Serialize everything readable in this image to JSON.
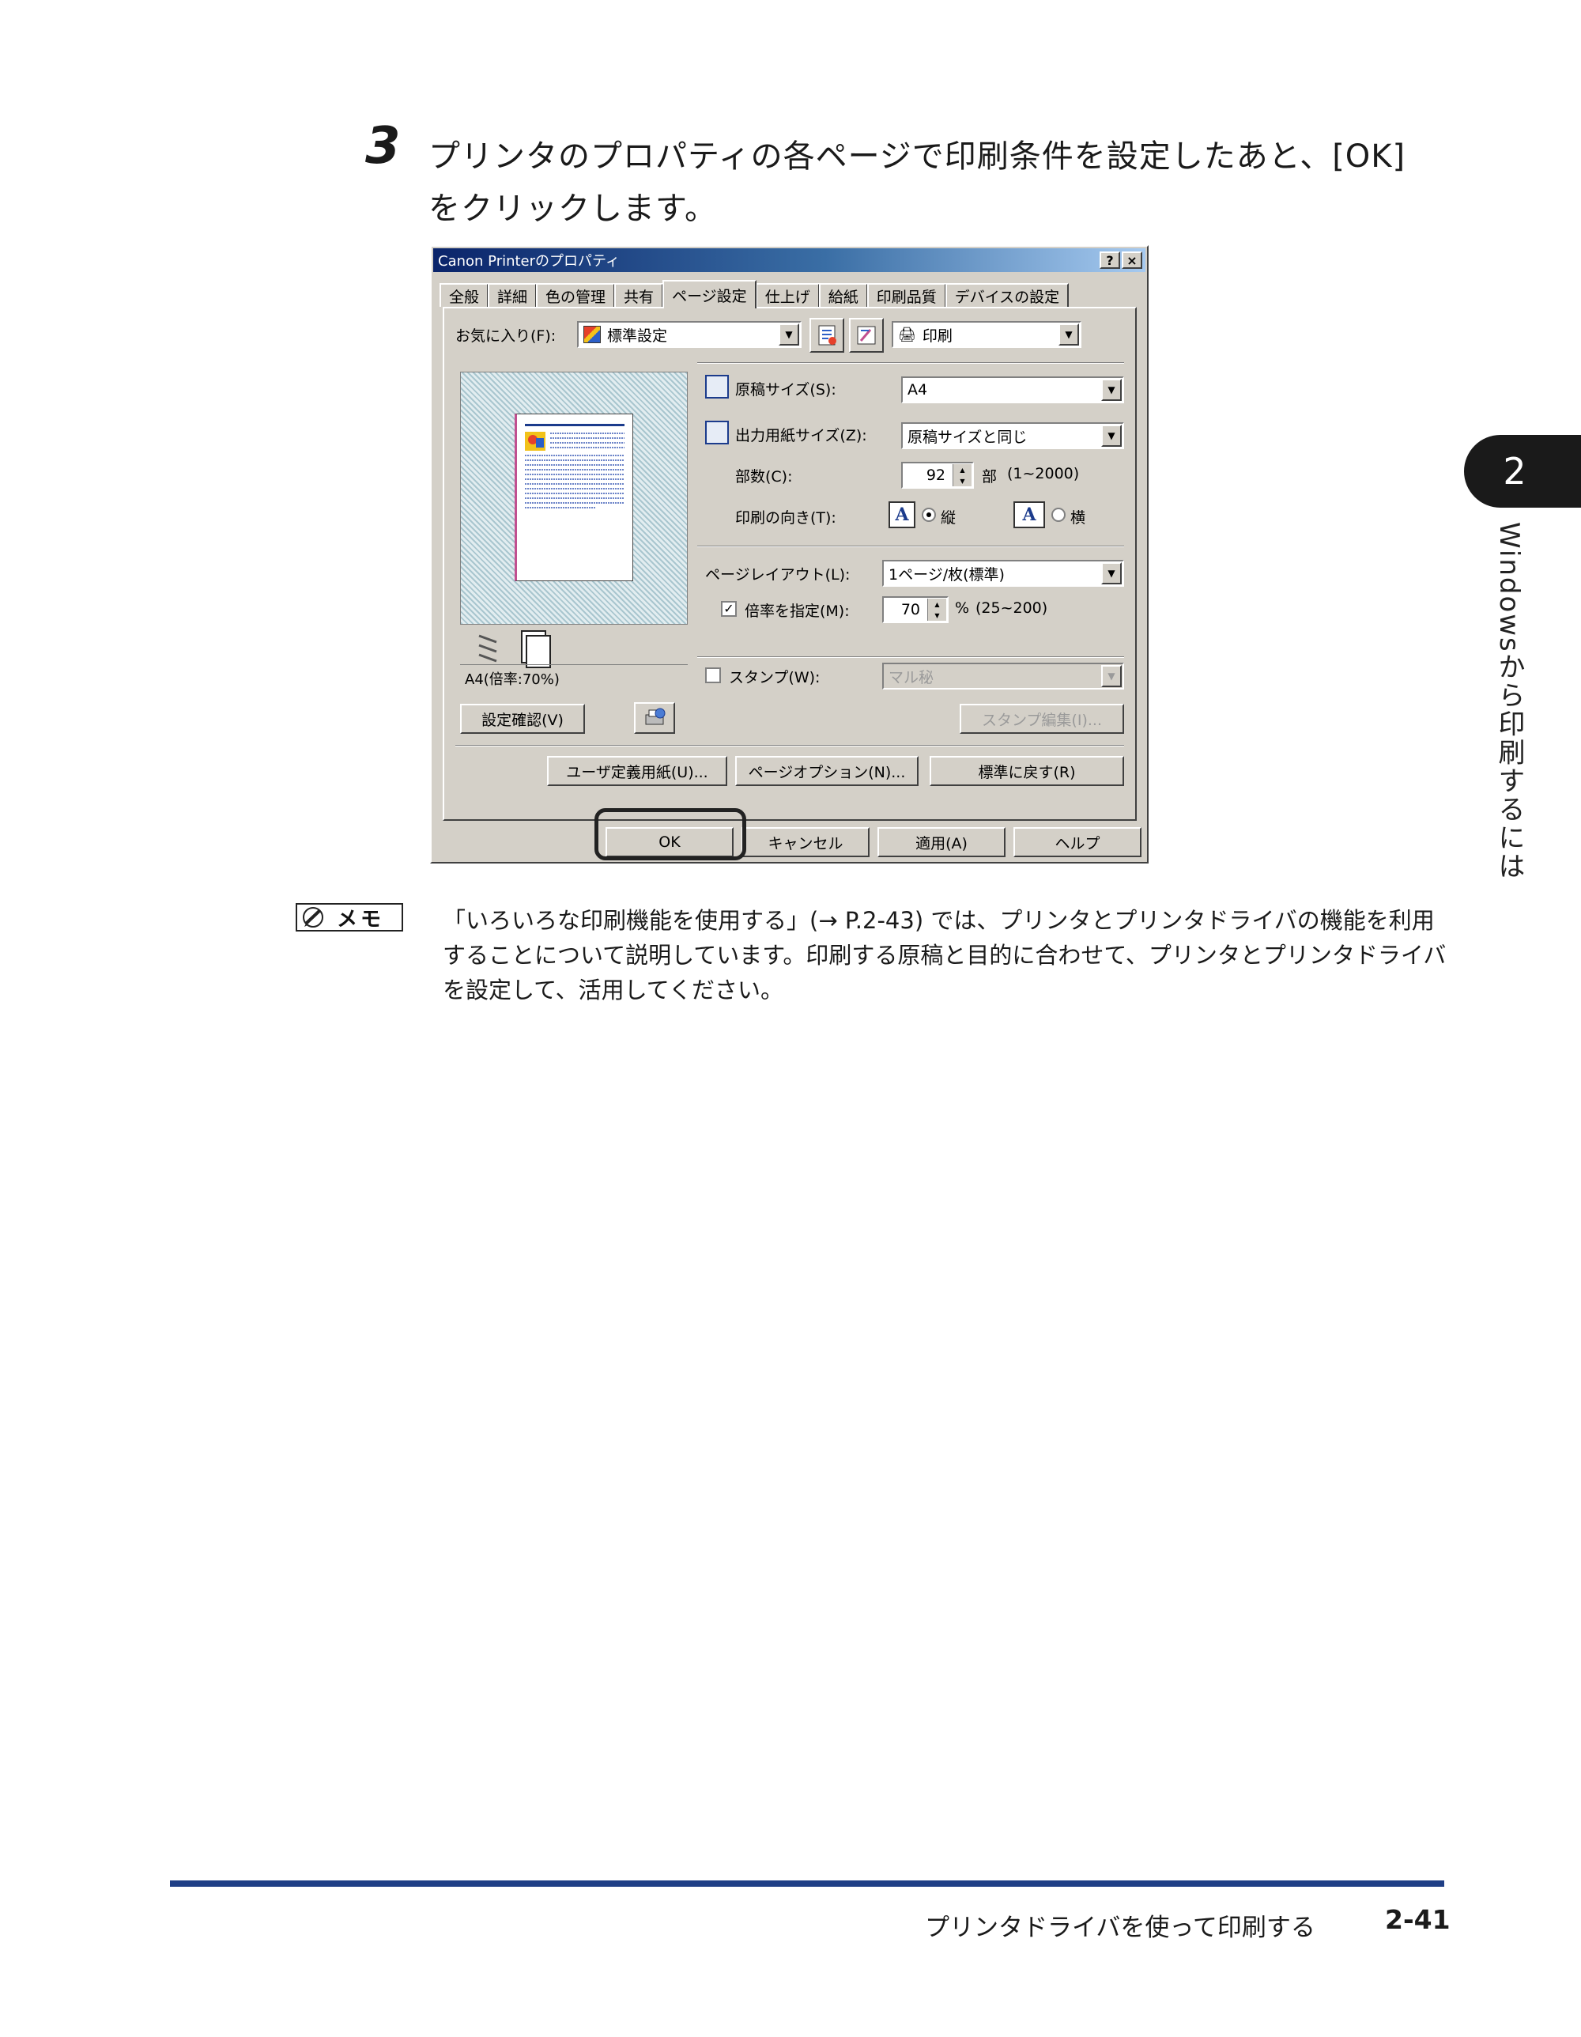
{
  "step": {
    "number": "3",
    "text": "プリンタのプロパティの各ページで印刷条件を設定したあと、[OK] をクリックします。"
  },
  "dialog": {
    "title": "Canon Printerのプロパティ",
    "help_btn": "?",
    "close_btn": "×",
    "tabs": [
      "全般",
      "詳細",
      "色の管理",
      "共有",
      "ページ設定",
      "仕上げ",
      "給紙",
      "印刷品質",
      "デバイスの設定"
    ],
    "active_tab": "ページ設定",
    "favorites": {
      "label": "お気に入り(F):",
      "value": "標準設定"
    },
    "output_method": {
      "value": "印刷"
    },
    "preview_caption": "A4(倍率:70%)",
    "original_size": {
      "label": "原稿サイズ(S):",
      "value": "A4"
    },
    "output_size": {
      "label": "出力用紙サイズ(Z):",
      "value": "原稿サイズと同じ"
    },
    "copies": {
      "label": "部数(C):",
      "value": "92",
      "unit": "部",
      "range": "(1~2000)"
    },
    "orientation": {
      "label": "印刷の向き(T):",
      "portrait": "縦",
      "landscape": "横",
      "icon_letter": "A"
    },
    "page_layout": {
      "label": "ページレイアウト(L):",
      "value": "1ページ/枚(標準)"
    },
    "scale": {
      "label": "倍率を指定(M):",
      "value": "70",
      "unit": "%",
      "range": "(25~200)",
      "check_mark": "✓"
    },
    "stamp": {
      "label": "スタンプ(W):",
      "value": "マル秘"
    },
    "buttons": {
      "check_settings": "設定確認(V)",
      "stamp_edit": "スタンプ編集(I)...",
      "custom_paper": "ユーザ定義用紙(U)...",
      "page_options": "ページオプション(N)...",
      "restore_defaults": "標準に戻す(R)",
      "ok": "OK",
      "cancel": "キャンセル",
      "apply": "適用(A)",
      "help": "ヘルプ"
    }
  },
  "memo": {
    "badge": "メモ",
    "text": "「いろいろな印刷機能を使用する」(→ P.2-43) では、プリンタとプリンタドライバの機能を利用することについて説明しています。印刷する原稿と目的に合わせて、プリンタとプリンタドライバを設定して、活用してください。"
  },
  "side": {
    "chapter_number": "2",
    "chapter_title": "Windowsから印刷するには"
  },
  "footer": {
    "title": "プリンタドライバを使って印刷する",
    "page": "2-41"
  },
  "colors": {
    "footer_rule": "#1f3f86",
    "titlebar_start": "#0a246a",
    "dialog_face": "#d4d0c8"
  }
}
